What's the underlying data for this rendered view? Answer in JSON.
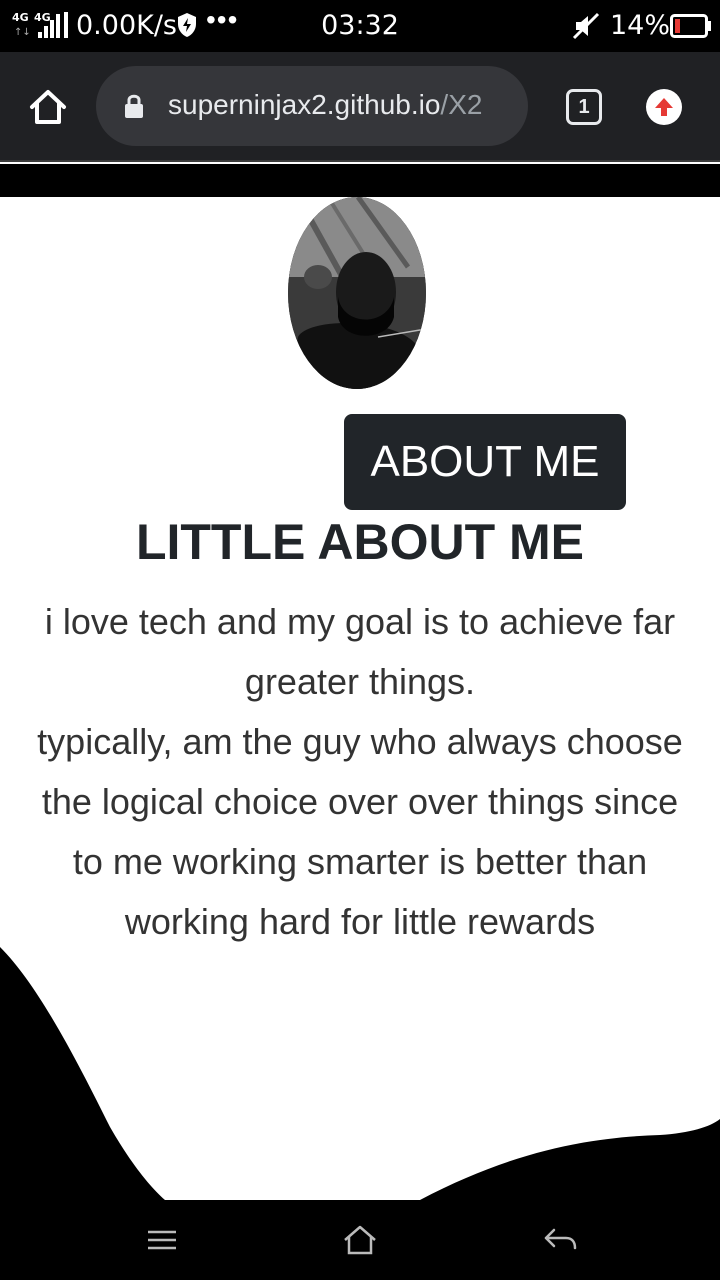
{
  "status_bar": {
    "network_1": "4G",
    "network_2": "4G",
    "speed": "0.00K/s",
    "more": "•••",
    "time": "03:32",
    "battery": "14%"
  },
  "browser": {
    "url_domain": "superninjax2.github.io",
    "url_path": "/X2",
    "tab_count": "1"
  },
  "page": {
    "about_button": "ABOUT ME",
    "title": "LITTLE ABOUT ME",
    "bio_lines": [
      "i love tech and my goal is to achieve far",
      "greater things.",
      "typically, am the guy who always choose",
      "the logical choice over over things since",
      "to me working smarter is better than",
      "working hard for little rewards"
    ]
  },
  "colors": {
    "button_bg": "#212529",
    "toolbar_bg": "#202124",
    "url_box_bg": "#35363a",
    "update_arrow": "#e53935",
    "battery_low": "#e53935"
  }
}
